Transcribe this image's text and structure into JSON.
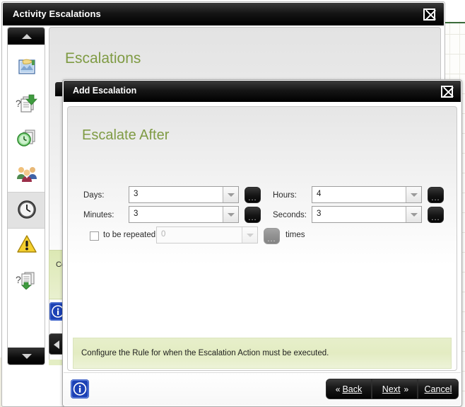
{
  "outer_window": {
    "title": "Activity Escalations",
    "close_icon": "close-x-icon",
    "scroll_up_icon": "scroll-up-arrow-icon",
    "scroll_down_icon": "scroll-down-arrow-icon",
    "sidebar": {
      "items": [
        {
          "icon": "image-document-icon",
          "label": ""
        },
        {
          "icon": "question-document-download-icon",
          "label": ""
        },
        {
          "icon": "clock-documents-icon",
          "label": ""
        },
        {
          "icon": "users-group-icon",
          "label": ""
        },
        {
          "icon": "clock-icon",
          "label": "",
          "selected": true
        },
        {
          "icon": "warning-triangle-icon",
          "label": ""
        },
        {
          "icon": "question-document-download-green-icon",
          "label": ""
        }
      ]
    },
    "main": {
      "heading": "Escalations",
      "partial_green_text": "Co",
      "partial_green_text2": "Co",
      "info_icon": "info-circle-icon",
      "back_icon": "back-chevron-icon"
    }
  },
  "dialog": {
    "title": "Add Escalation",
    "close_icon": "close-x-icon",
    "heading": "Escalate After",
    "fields": [
      {
        "label": "Days:",
        "value": "3",
        "name": "days",
        "disabled": false,
        "ellipsis": "...",
        "arrow_icon": "chevron-down-icon"
      },
      {
        "label": "Hours:",
        "value": "4",
        "name": "hours",
        "disabled": false,
        "ellipsis": "...",
        "arrow_icon": "chevron-down-icon"
      },
      {
        "label": "Minutes:",
        "value": "3",
        "name": "minutes",
        "disabled": false,
        "ellipsis": "...",
        "arrow_icon": "chevron-down-icon"
      },
      {
        "label": "Seconds:",
        "value": "3",
        "name": "seconds",
        "disabled": false,
        "ellipsis": "...",
        "arrow_icon": "chevron-down-icon"
      }
    ],
    "repeat": {
      "checkbox_checked": false,
      "label": "to be repeated",
      "value": "0",
      "ellipsis": "...",
      "suffix": "times",
      "disabled": true,
      "arrow_icon": "chevron-down-icon"
    },
    "hint": "Configure the Rule for when the Escalation Action must be executed.",
    "footer": {
      "info_icon": "info-circle-icon",
      "back_label": "Back",
      "back_chevrons": "«",
      "next_label": "Next",
      "next_chevrons": "»",
      "cancel_label": "Cancel"
    }
  },
  "colors": {
    "heading_green": "#7f9b44",
    "hint_bg": "#e3ecc2",
    "titlebar_black": "#000000",
    "info_blue": "#1c41b5"
  }
}
